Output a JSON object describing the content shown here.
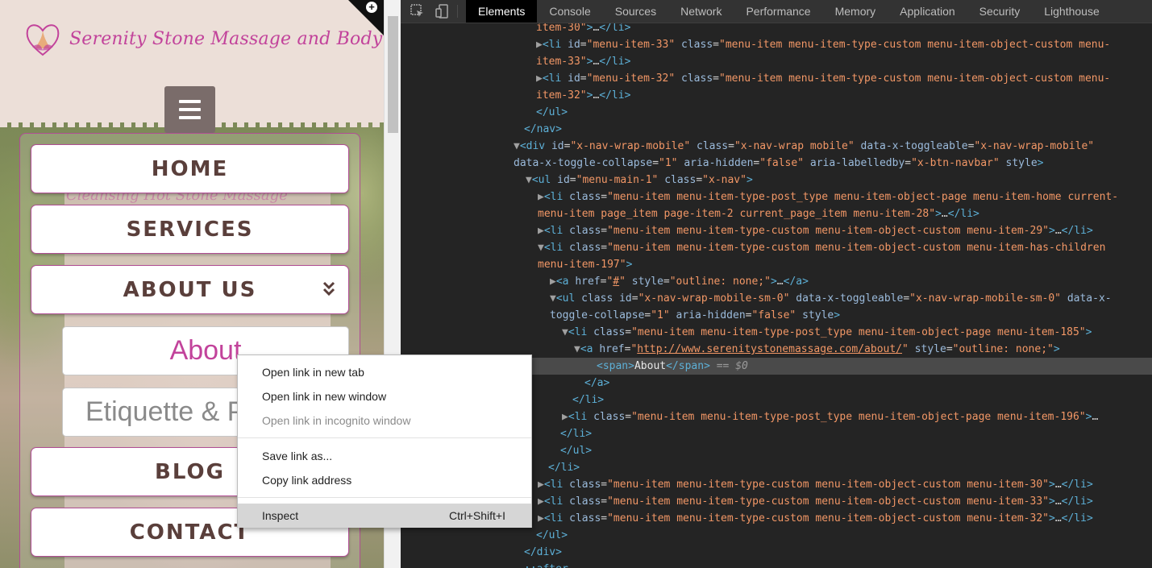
{
  "site": {
    "title": "Serenity Stone Massage and Bodywork",
    "ghost_text": "Cleansing Hot Stone Massage",
    "menu": [
      {
        "label": "HOME"
      },
      {
        "label": "SERVICES"
      },
      {
        "label": "ABOUT US"
      },
      {
        "label": "BLOG"
      },
      {
        "label": "CONTACT"
      }
    ],
    "submenu": [
      {
        "label": "About"
      },
      {
        "label": "Etiquette & P"
      }
    ]
  },
  "context_menu": {
    "items": [
      {
        "label": "Open link in new tab",
        "shortcut": ""
      },
      {
        "label": "Open link in new window",
        "shortcut": ""
      },
      {
        "label": "Open link in incognito window",
        "shortcut": ""
      },
      {
        "label": "Save link as...",
        "shortcut": ""
      },
      {
        "label": "Copy link address",
        "shortcut": ""
      },
      {
        "label": "Inspect",
        "shortcut": "Ctrl+Shift+I"
      }
    ]
  },
  "devtools": {
    "tabs": [
      "Elements",
      "Console",
      "Sources",
      "Network",
      "Performance",
      "Memory",
      "Application",
      "Security",
      "Lighthouse"
    ],
    "active_tab": "Elements",
    "selected_text": "About",
    "selected_marker": "== $0",
    "about_url": "http://www.serenitystonemassage.com/about/"
  },
  "colors": {
    "brand_pink": "#c2439b",
    "menu_border": "#b04e94",
    "menu_text": "#5a3f3b",
    "devtools_bg": "#242424",
    "tag_color": "#5db0d7",
    "attr_name": "#9bbbdc",
    "attr_value": "#f29766"
  }
}
